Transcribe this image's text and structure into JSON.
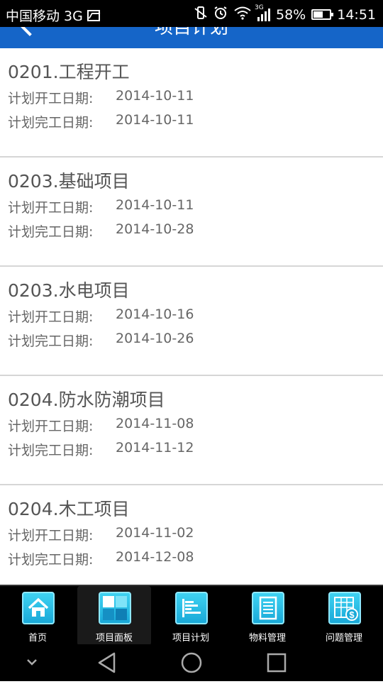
{
  "status_bar": {
    "carrier": "中国移动 3G",
    "network_tag": "3G",
    "battery": "58%",
    "battery_level": 0.58,
    "time": "14:51"
  },
  "header": {
    "title": "项目计划"
  },
  "items": [
    {
      "name": "0201.工程开工",
      "start_label": "计划开工日期:",
      "start": "2014-10-11",
      "end_label": "计划完工日期:",
      "end": "2014-10-11"
    },
    {
      "name": "0203.基础项目",
      "start_label": "计划开工日期:",
      "start": "2014-10-11",
      "end_label": "计划完工日期:",
      "end": "2014-10-28"
    },
    {
      "name": "0203.水电项目",
      "start_label": "计划开工日期:",
      "start": "2014-10-16",
      "end_label": "计划完工日期:",
      "end": "2014-10-26"
    },
    {
      "name": "0204.防水防潮项目",
      "start_label": "计划开工日期:",
      "start": "2014-11-08",
      "end_label": "计划完工日期:",
      "end": "2014-11-12"
    },
    {
      "name": "0204.木工项目",
      "start_label": "计划开工日期:",
      "start": "2014-11-02",
      "end_label": "计划完工日期:",
      "end": "2014-12-08"
    }
  ],
  "bottom_nav": [
    {
      "label": "首页",
      "icon": "home-icon"
    },
    {
      "label": "项目面板",
      "icon": "dashboard-icon",
      "active": true
    },
    {
      "label": "项目计划",
      "icon": "bar-list-icon"
    },
    {
      "label": "物料管理",
      "icon": "document-icon"
    },
    {
      "label": "问题管理",
      "icon": "dollar-grid-icon"
    }
  ],
  "colors": {
    "header_bg": "#1565c8",
    "icon_gradient_top": "#3fd3f2",
    "icon_gradient_bottom": "#19a9d8"
  }
}
